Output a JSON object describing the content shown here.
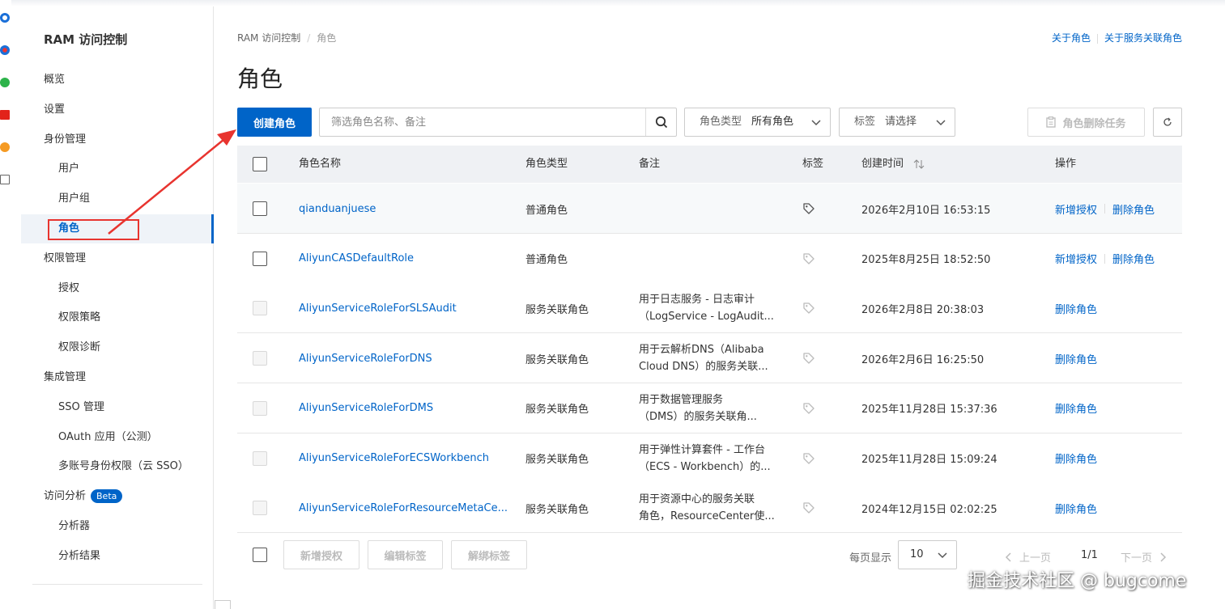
{
  "colors": {
    "accent": "#0064c8",
    "annotation": "#e8342f"
  },
  "rail_icons": [
    "q-icon",
    "browser-icon",
    "plant-icon",
    "red-app-icon",
    "orange-s-icon",
    "plus-square-icon"
  ],
  "sidebar": {
    "title": "RAM 访问控制",
    "items": [
      {
        "label": "概览",
        "level": 1
      },
      {
        "label": "设置",
        "level": 1
      },
      {
        "label": "身份管理",
        "level": 1
      },
      {
        "label": "用户",
        "level": 2
      },
      {
        "label": "用户组",
        "level": 2
      },
      {
        "label": "角色",
        "level": 2,
        "active": true
      },
      {
        "label": "权限管理",
        "level": 1
      },
      {
        "label": "授权",
        "level": 2
      },
      {
        "label": "权限策略",
        "level": 2
      },
      {
        "label": "权限诊断",
        "level": 2
      },
      {
        "label": "集成管理",
        "level": 1
      },
      {
        "label": "SSO 管理",
        "level": 2
      },
      {
        "label": "OAuth 应用（公测）",
        "level": 2
      },
      {
        "label": "多账号身份权限（云 SSO）",
        "level": 2
      },
      {
        "label": "访问分析",
        "level": 1,
        "badge": "Beta"
      },
      {
        "label": "分析器",
        "level": 2
      },
      {
        "label": "分析结果",
        "level": 2
      }
    ]
  },
  "breadcrumb": {
    "root": "RAM 访问控制",
    "sep": "/",
    "current": "角色"
  },
  "top_links": {
    "about_role": "关于角色",
    "about_service_role": "关于服务关联角色"
  },
  "page_title": "角色",
  "toolbar": {
    "create_label": "创建角色",
    "search_placeholder": "筛选角色名称、备注",
    "role_type_label": "角色类型",
    "role_type_value": "所有角色",
    "tag_label": "标签",
    "tag_value": "请选择",
    "delete_task_label": "角色删除任务"
  },
  "table": {
    "headers": {
      "name": "角色名称",
      "type": "角色类型",
      "note": "备注",
      "tag": "标签",
      "created": "创建时间",
      "ops": "操作"
    },
    "rows": [
      {
        "name": "qianduanjuese",
        "type": "普通角色",
        "note1": "",
        "note2": "",
        "created": "2026年2月10日 16:53:15",
        "op1": "新增授权",
        "op2": "删除角色",
        "selectable": true
      },
      {
        "name": "AliyunCASDefaultRole",
        "type": "普通角色",
        "note1": "",
        "note2": "",
        "created": "2025年8月25日 18:52:50",
        "op1": "新增授权",
        "op2": "删除角色",
        "selectable": true
      },
      {
        "name": "AliyunServiceRoleForSLSAudit",
        "type": "服务关联角色",
        "note1": "用于日志服务 - 日志审计",
        "note2": "（LogService - LogAudit...",
        "created": "2026年2月8日 20:38:03",
        "op1": "删除角色",
        "op2": "",
        "selectable": false
      },
      {
        "name": "AliyunServiceRoleForDNS",
        "type": "服务关联角色",
        "note1": "用于云解析DNS（Alibaba",
        "note2": "Cloud DNS）的服务关联...",
        "created": "2026年2月6日 16:25:50",
        "op1": "删除角色",
        "op2": "",
        "selectable": false
      },
      {
        "name": "AliyunServiceRoleForDMS",
        "type": "服务关联角色",
        "note1": "用于数据管理服务",
        "note2": "（DMS）的服务关联角...",
        "created": "2025年11月28日 15:37:36",
        "op1": "删除角色",
        "op2": "",
        "selectable": false
      },
      {
        "name": "AliyunServiceRoleForECSWorkbench",
        "type": "服务关联角色",
        "note1": "用于弹性计算套件 - 工作台",
        "note2": "（ECS - Workbench）的...",
        "created": "2025年11月28日 15:09:24",
        "op1": "删除角色",
        "op2": "",
        "selectable": false
      },
      {
        "name": "AliyunServiceRoleForResourceMetaCe...",
        "type": "服务关联角色",
        "note1": "用于资源中心的服务关联",
        "note2": "角色，ResourceCenter使...",
        "created": "2024年12月15日 02:02:25",
        "op1": "删除角色",
        "op2": "",
        "selectable": false
      }
    ]
  },
  "footer": {
    "add_auth": "新增授权",
    "edit_tag": "编辑标签",
    "remove_tag": "解绑标签",
    "per_page_label": "每页显示",
    "per_page_value": "10",
    "prev": "上一页",
    "page": "1/1",
    "next": "下一页"
  },
  "watermark": "掘金技术社区 @ bugcome"
}
